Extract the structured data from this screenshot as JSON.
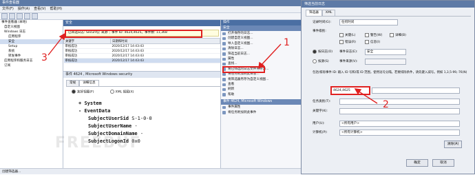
{
  "main_window": {
    "title": "事件查看器",
    "menu": [
      "文件(F)",
      "操作(A)",
      "查看(V)",
      "帮助(H)"
    ],
    "statusbar": "创建筛选器..."
  },
  "tree": {
    "items": [
      "事件查看器 (本地)",
      "自定义视图",
      "Windows 日志",
      "应用程序",
      "安全",
      "Setup",
      "系统",
      "转发事件",
      "应用程序和服务日志",
      "订阅"
    ]
  },
  "log_pane": {
    "header": "安全",
    "info": "已筛选日志: Security; 来源: ; 事件 ID: 4624,4625。事件数: 11,368",
    "columns": [
      "关键字",
      "日期和时间"
    ],
    "rows": [
      [
        "审核成功",
        "2020/12/17 14:43:43"
      ],
      [
        "审核成功",
        "2020/12/17 14:43:43"
      ],
      [
        "审核成功",
        "2020/12/17 14:43:43"
      ],
      [
        "审核成功",
        "2020/12/17 14:43:43"
      ]
    ]
  },
  "event_detail": {
    "header": "事件 4624 , Microsoft Windows security",
    "tabs": [
      "常规",
      "详细信息"
    ],
    "view_friendly": "友好视图(F)",
    "view_xml": "XML 视图(X)",
    "lines": [
      "System",
      "EventData",
      "SubjectUserSid",
      "S-1-0-0",
      "SubjectUserName",
      "-",
      "SubjectDomainName",
      "-",
      "SubjectLogonId",
      "0x0"
    ]
  },
  "actions": {
    "header": "操作",
    "section1": "安全",
    "items": [
      "打开保存的日志...",
      "创建自定义视图...",
      "导入自定义视图...",
      "清除日志...",
      "筛选当前日志...",
      "属性",
      "查找...",
      "将已筛选的日志文件另存为...",
      "将任务附加到此日志...",
      "将筛选器另存为自定义视图...",
      "查看",
      "刷新",
      "帮助"
    ],
    "section2": "事件 4624, Microsoft Windows",
    "items2": [
      "事件属性",
      "将任务附加到此事件"
    ]
  },
  "filter_dialog": {
    "title": "筛选当前日志",
    "tabs": [
      "筛选器",
      "XML"
    ],
    "recorded_label": "记录时间(G):",
    "recorded_value": "任何时间",
    "level_label": "事件级别:",
    "levels": [
      "关键(L)",
      "警告(W)",
      "详细(B)",
      "错误(R)",
      "信息(I)"
    ],
    "by_log": "按日志(O)",
    "by_log_label": "事件日志(E):",
    "by_log_value": "安全",
    "by_source": "按源(S)",
    "by_source_label": "事件来源(V):",
    "id_description": "包括/排除事件 ID: 输入 ID 号和/或 ID 范围，使用逗号分隔。若要排除条件，请先键入减号。例如 1,3,5-99,-76(N)",
    "event_ids": "4624,4625",
    "task_label": "任务类别(T):",
    "keyword_label": "关键字(K):",
    "user_label": "用户(U):",
    "user_value": "<所有用户>",
    "computer_label": "计算机(P):",
    "computer_value": "<所有计算机>",
    "clear_button": "清除(A)",
    "ok_button": "确定",
    "cancel_button": "取消"
  },
  "annotations": [
    "1",
    "2",
    "3"
  ],
  "watermark": "FREEBUF"
}
